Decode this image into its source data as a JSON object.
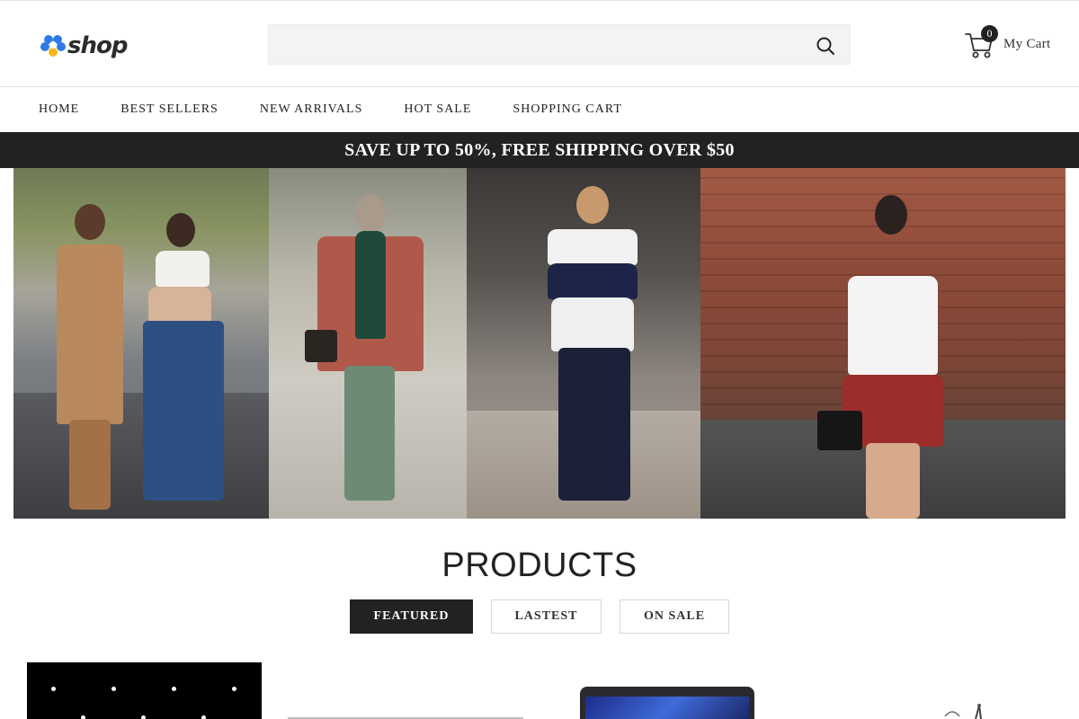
{
  "header": {
    "logo_text": "shop",
    "search": {
      "placeholder": "",
      "value": ""
    },
    "cart": {
      "count": "0",
      "label": "My Cart"
    }
  },
  "nav": {
    "items": [
      {
        "label": "HOME"
      },
      {
        "label": "BEST SELLERS"
      },
      {
        "label": "NEW ARRIVALS"
      },
      {
        "label": "HOT SALE"
      },
      {
        "label": "SHOPPING CART"
      }
    ]
  },
  "promo": {
    "text": "SAVE UP TO 50%, FREE SHIPPING OVER $50"
  },
  "products": {
    "title": "PRODUCTS",
    "tabs": [
      {
        "label": "FEATURED",
        "active": true
      },
      {
        "label": "LASTEST",
        "active": false
      },
      {
        "label": "ON SALE",
        "active": false
      }
    ]
  },
  "colors": {
    "promo_bg": "#222222",
    "active_tab_bg": "#222222",
    "logo_blue": "#2f7be5",
    "logo_yellow": "#f5b81c"
  }
}
